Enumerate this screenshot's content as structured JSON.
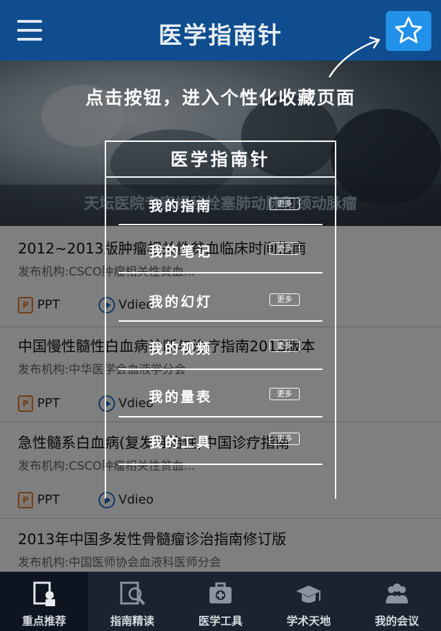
{
  "header": {
    "title": "医学指南针"
  },
  "banner": {
    "caption": "天坛医院专家揭秘栓塞肺动脉和颈动脉瘤"
  },
  "list": [
    {
      "title": "2012~2013版肿瘤相关性贫血临床时间指南",
      "publisher": "发布机构:CSCO肿瘤相关性贫血...",
      "ppt_label": "PPT",
      "video_label": "Vdieo"
    },
    {
      "title": "中国慢性髓性白血病诊断与治疗指南2013版本",
      "publisher": "发布机构:中华医学会血液学分会",
      "ppt_label": "PPT",
      "video_label": "Vdieo"
    },
    {
      "title": "急性髓系白血病(复发难治性)中国诊疗指南",
      "publisher": "发布机构:CSCO肿瘤相关性贫血...",
      "ppt_label": "PPT",
      "video_label": "Vdieo"
    },
    {
      "title": "2013年中国多发性骨髓瘤诊治指南修订版",
      "publisher": "发布机构:中国医师协会血液科医师分会"
    }
  ],
  "overlay": {
    "hint": "点击按钮，进入个性化收藏页面",
    "menu_title": "医学指南针",
    "more_label": "更多",
    "items": [
      {
        "label": "我的指南"
      },
      {
        "label": "我的笔记"
      },
      {
        "label": "我的幻灯"
      },
      {
        "label": "我的视频"
      },
      {
        "label": "我的量表"
      },
      {
        "label": "我的工具"
      }
    ]
  },
  "tabs": [
    {
      "label": "重点推荐",
      "icon": "document-person-icon",
      "active": true
    },
    {
      "label": "指南精读",
      "icon": "magnifier-icon",
      "active": false
    },
    {
      "label": "医学工具",
      "icon": "medical-kit-icon",
      "active": false
    },
    {
      "label": "学术天地",
      "icon": "graduation-cap-icon",
      "active": false
    },
    {
      "label": "我的会议",
      "icon": "meeting-people-icon",
      "active": false
    }
  ],
  "colors": {
    "header_bg": "#0f4d8f",
    "favorite_button": "#2291ea",
    "tabbar_bg": "#1b2330"
  }
}
